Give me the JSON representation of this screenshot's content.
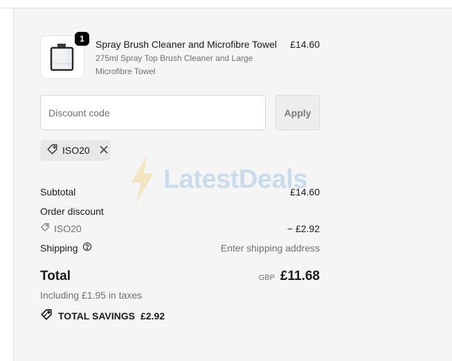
{
  "product": {
    "quantity": "1",
    "name": "Spray Brush Cleaner and Microfibre Towel",
    "description": "275ml Spray Top Brush Cleaner and Large Microfibre Towel",
    "price": "£14.60"
  },
  "discount": {
    "placeholder": "Discount code",
    "apply_label": "Apply",
    "applied_code": "ISO20"
  },
  "watermark": {
    "text": "LatestDeals"
  },
  "summary": {
    "subtotal_label": "Subtotal",
    "subtotal_value": "£14.60",
    "order_discount_label": "Order discount",
    "discount_code": "ISO20",
    "discount_value": "− £2.92",
    "shipping_label": "Shipping",
    "shipping_value": "Enter shipping address",
    "total_label": "Total",
    "currency": "GBP",
    "total_value": "£11.68",
    "taxes_note": "Including £1.95 in taxes",
    "savings_label": "TOTAL SAVINGS",
    "savings_value": "£2.92"
  },
  "icons": {
    "tag": "tag-icon",
    "close": "close-icon",
    "help": "help-circle-icon",
    "savings": "savings-tag-icon"
  },
  "colors": {
    "panel_bg": "#f5f5f5",
    "muted_text": "#707070",
    "badge_bg": "#000000"
  }
}
